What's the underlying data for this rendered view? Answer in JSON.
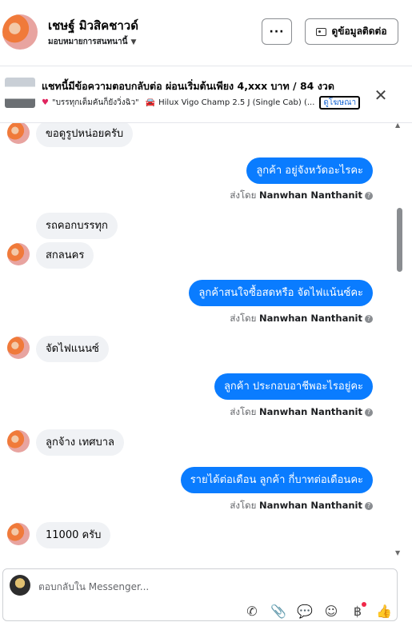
{
  "header": {
    "name": "เชษฐ์ มิวสิคชาวด์",
    "assignee_label": "มอบหมายการสนทนานี้",
    "more_label": "···",
    "contact_label": "ดูข้อมูลติดต่อ"
  },
  "ad": {
    "title": "แชทนี้มีข้อความตอบกลับต่อ ผ่อนเริ่มต้นเพียง 4,xxx บาท / 84 งวด",
    "subtitle": "\"บรรทุกเต็มคันก็ยังวิ่งฉิว\"",
    "product": "Hilux Vigo Champ 2.5 J (Single Cab) (...",
    "link_label": "ดูโฆษณา",
    "close_label": "✕"
  },
  "messages": [
    {
      "dir": "in",
      "text": "ขอดูรูปหน่อยครับ"
    },
    {
      "dir": "out",
      "text": "ลูกค้า อยู่จังหวัดอะไรคะ",
      "sent_prefix": "ส่งโดย",
      "sender": "Nanwhan Nanthanit"
    },
    {
      "dir": "in",
      "text": "รถคอกบรรทุก"
    },
    {
      "dir": "in",
      "text": "สกลนคร"
    },
    {
      "dir": "out",
      "text": "ลูกค้าสนใจซื้อสดหรือ จัดไฟแน้นซ์คะ",
      "sent_prefix": "ส่งโดย",
      "sender": "Nanwhan Nanthanit"
    },
    {
      "dir": "in",
      "text": "จัดไฟแนนซ์"
    },
    {
      "dir": "out",
      "text": "ลูกค้า ประกอบอาชีพอะไรอยู่คะ",
      "sent_prefix": "ส่งโดย",
      "sender": "Nanwhan Nanthanit"
    },
    {
      "dir": "in",
      "text": "ลูกจ้าง เทศบาล"
    },
    {
      "dir": "out",
      "text": "รายได้ต่อเดือน  ลูกค้า กี่บาทต่อเดือนคะ",
      "sent_prefix": "ส่งโดย",
      "sender": "Nanwhan Nanthanit"
    },
    {
      "dir": "in",
      "text": "11000 ครับ"
    }
  ],
  "composer": {
    "placeholder": "ตอบกลับใน Messenger..."
  },
  "colors": {
    "outgoing_bubble": "#0a7cff",
    "incoming_bubble": "#f0f2f5"
  }
}
